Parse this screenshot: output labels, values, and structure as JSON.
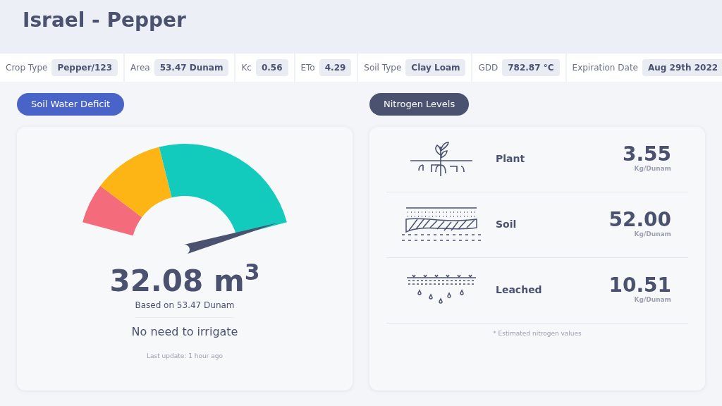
{
  "title": "Israel - Pepper",
  "info_bar": [
    {
      "label": "Crop Type",
      "value": "Pepper/123"
    },
    {
      "label": "Area",
      "value": "53.47 Dunam"
    },
    {
      "label": "Kc",
      "value": "0.56"
    },
    {
      "label": "ETo",
      "value": "4.29"
    },
    {
      "label": "Soil Type",
      "value": "Clay Loam"
    },
    {
      "label": "GDD",
      "value": "782.87 °C"
    },
    {
      "label": "Expiration Date",
      "value": "Aug 29th 2022"
    }
  ],
  "soil_water_deficit": {
    "heading": "Soil Water Deficit",
    "value": "32.08 m$^{3}$",
    "basis": "Based on 53.47 Dunam",
    "advice": "No need to irrigate",
    "last_update": "Last update: 1 hour ago"
  },
  "nitrogen_levels": {
    "heading": "Nitrogen Levels",
    "rows": [
      {
        "kind": "plant",
        "label": "Plant",
        "value": "3.55",
        "unit": "Kg/Dunam"
      },
      {
        "kind": "soil",
        "label": "Soil",
        "value": "52.00",
        "unit": "Kg/Dunam"
      },
      {
        "kind": "leached",
        "label": "Leached",
        "value": "10.51",
        "unit": "Kg/Dunam"
      }
    ],
    "footnote": "* Estimated nitrogen values"
  }
}
